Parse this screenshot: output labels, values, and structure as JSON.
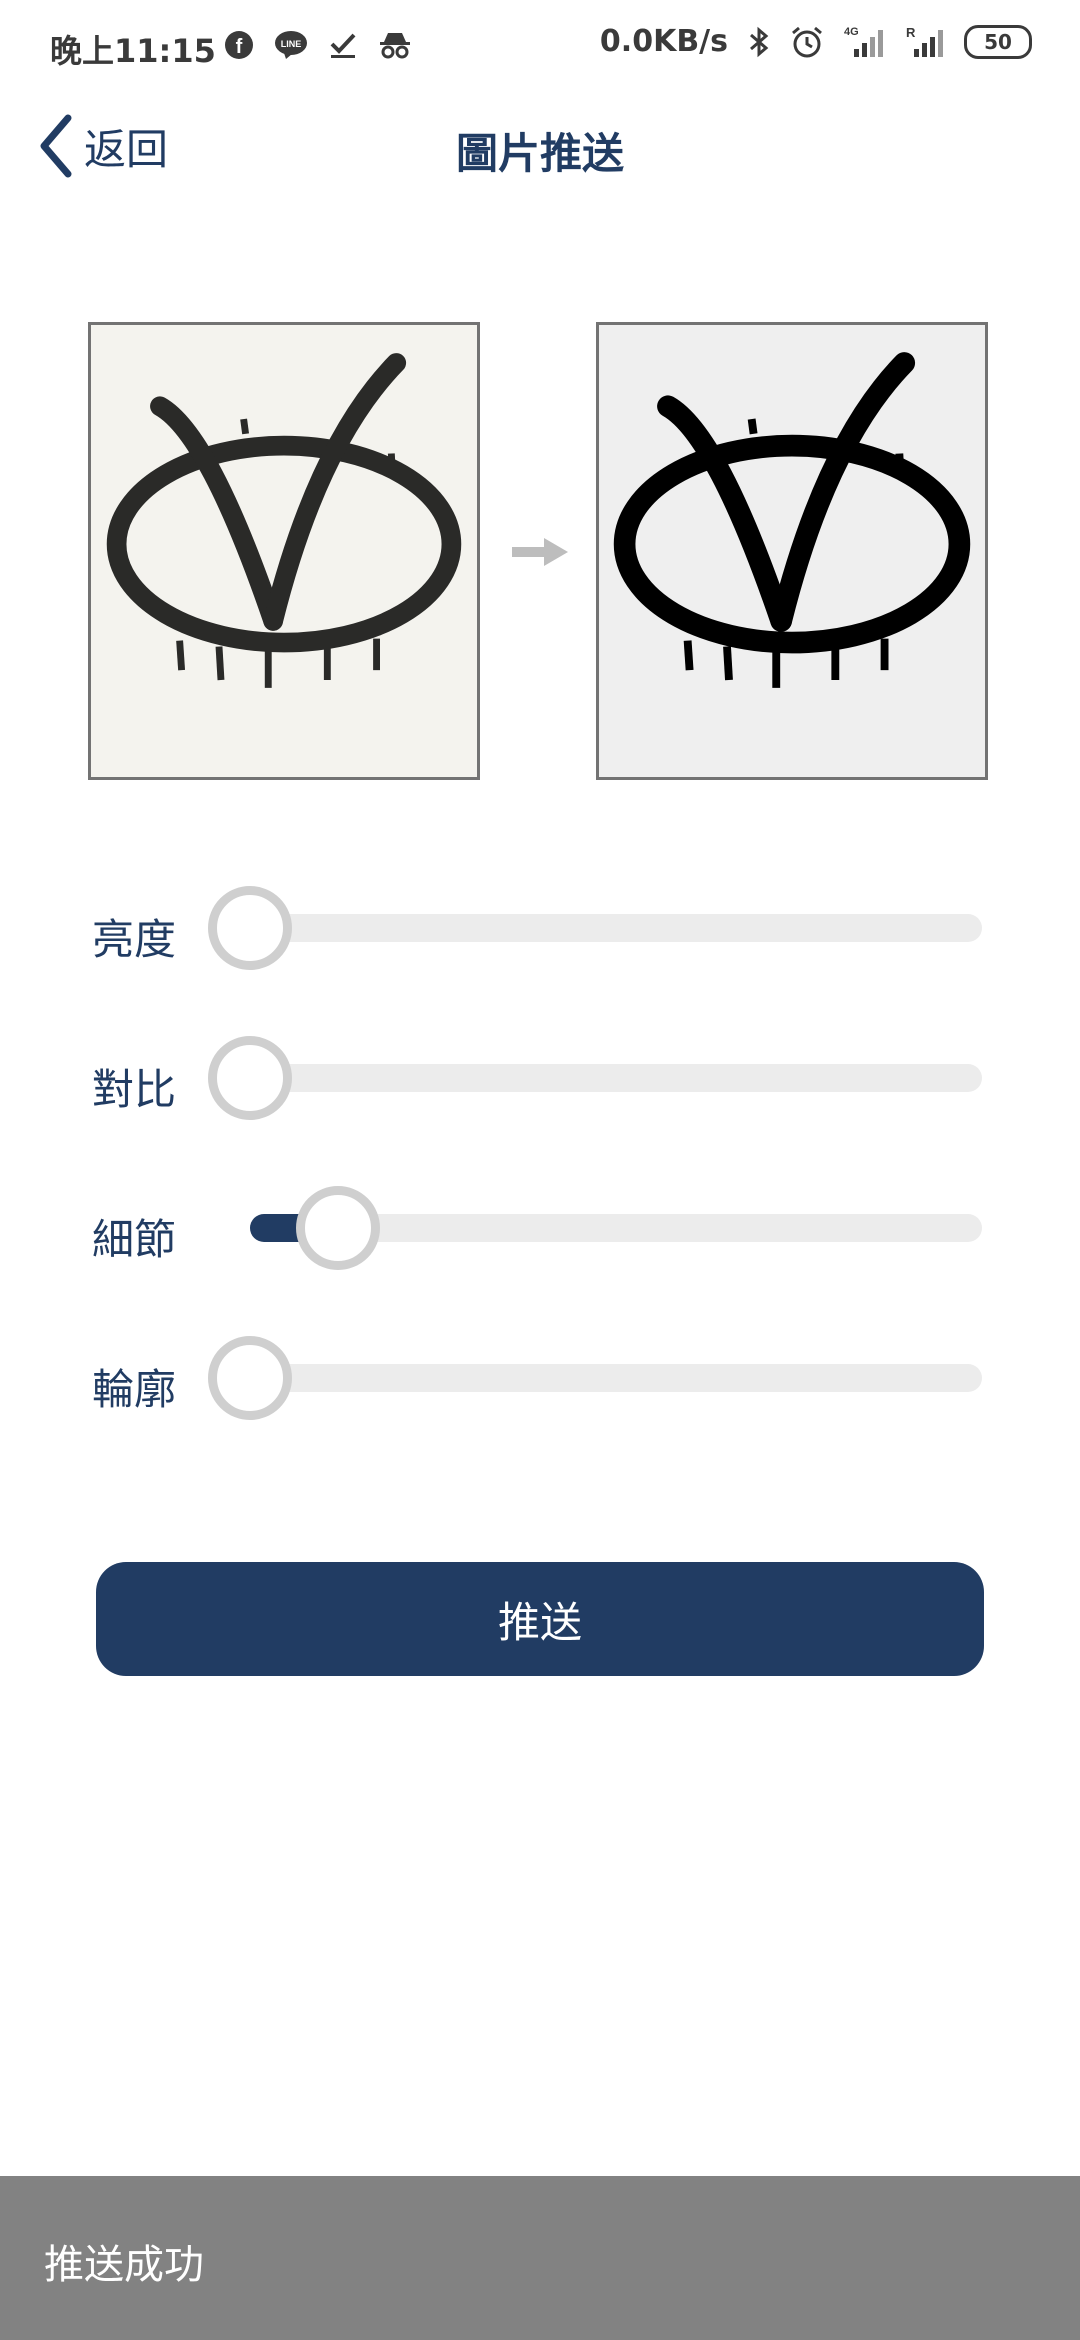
{
  "status_bar": {
    "time": "晚上11:15",
    "left_icons": [
      "facebook-icon",
      "line-icon",
      "checkmark-icon",
      "incognito-icon"
    ],
    "network_speed": "0.0KB/s",
    "right_icons": [
      "bluetooth-icon",
      "alarm-icon",
      "signal-4g-icon",
      "signal-roaming-icon"
    ],
    "signal_labels": {
      "first": "4G",
      "second": "R"
    },
    "battery": "50"
  },
  "header": {
    "back_label": "返回",
    "title": "圖片推送"
  },
  "preview": {
    "original_icon": "v-graffiti-logo-photo",
    "processed_icon": "v-graffiti-logo-bw",
    "arrow_icon": "arrow-right-icon"
  },
  "sliders": [
    {
      "label": "亮度",
      "value": 0.0
    },
    {
      "label": "對比",
      "value": 0.0
    },
    {
      "label": "細節",
      "value": 0.12
    },
    {
      "label": "輪廓",
      "value": 0.0
    }
  ],
  "push_button": {
    "label": "推送"
  },
  "toast": {
    "text": "推送成功"
  },
  "colors": {
    "brand_navy": "#213c63",
    "track": "#ececec",
    "thumb_ring": "#cfcfcf",
    "toast_bg": "#828282"
  }
}
